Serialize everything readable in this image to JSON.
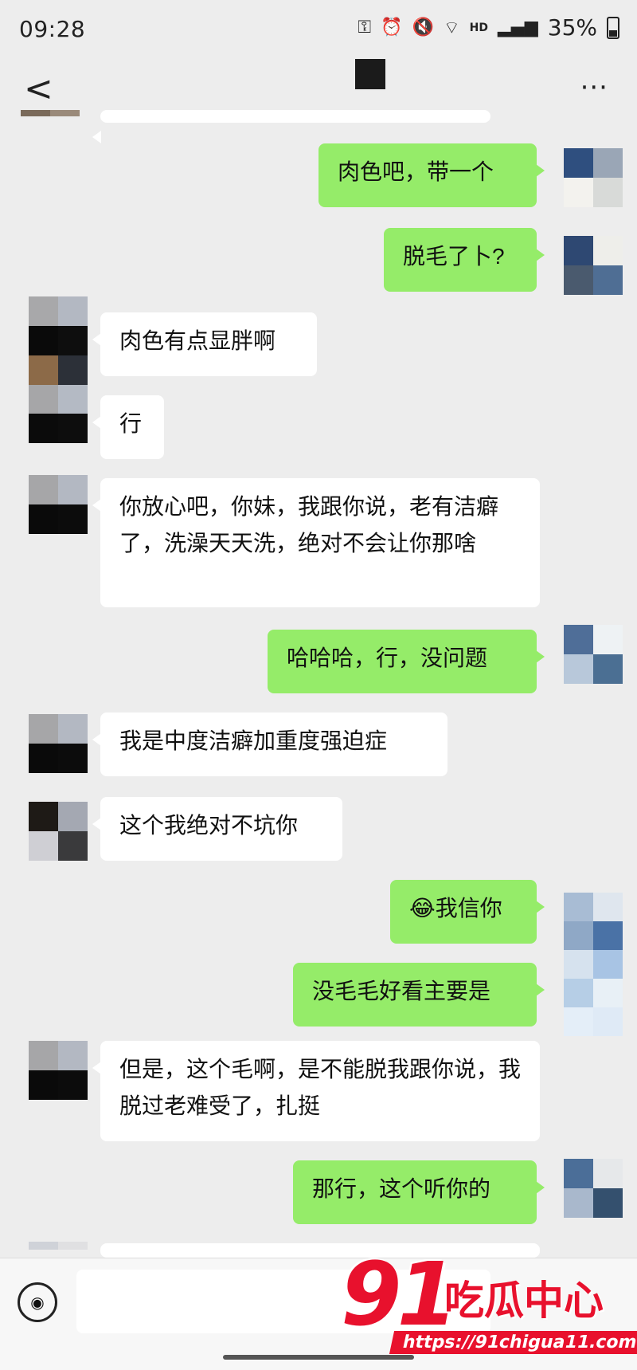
{
  "status": {
    "time": "09:28",
    "battery": "35%",
    "hd_label": "HD"
  },
  "nav": {
    "back_label": "<",
    "more_label": "···"
  },
  "messages": [
    {
      "text": "肉色吧，带一个",
      "side": "right"
    },
    {
      "text": "脱毛了卜?",
      "side": "right"
    },
    {
      "text": "肉色有点显胖啊",
      "side": "left"
    },
    {
      "text": "行",
      "side": "left"
    },
    {
      "text": "你放心吧，你妹，我跟你说，老有洁癖了，洗澡天天洗，绝对不会让你那啥",
      "side": "left"
    },
    {
      "text": "哈哈哈，行，没问题",
      "side": "right"
    },
    {
      "text": "我是中度洁癖加重度强迫症",
      "side": "left"
    },
    {
      "text": "这个我绝对不坑你",
      "side": "left"
    },
    {
      "text": "我信你",
      "emoji": "😂",
      "side": "right"
    },
    {
      "text": "没毛毛好看主要是",
      "side": "right"
    },
    {
      "text": "但是，这个毛啊，是不能脱我跟你说，我脱过老难受了，扎挺",
      "side": "left"
    },
    {
      "text": "那行，这个听你的",
      "side": "right"
    }
  ],
  "watermark": {
    "brand_number": "91",
    "brand_text": "吃瓜中心",
    "url": "https://91chigua11.com"
  },
  "colors": {
    "sent_bubble": "#95ec69",
    "received_bubble": "#ffffff",
    "background": "#ededed",
    "watermark": "#e8112d"
  }
}
